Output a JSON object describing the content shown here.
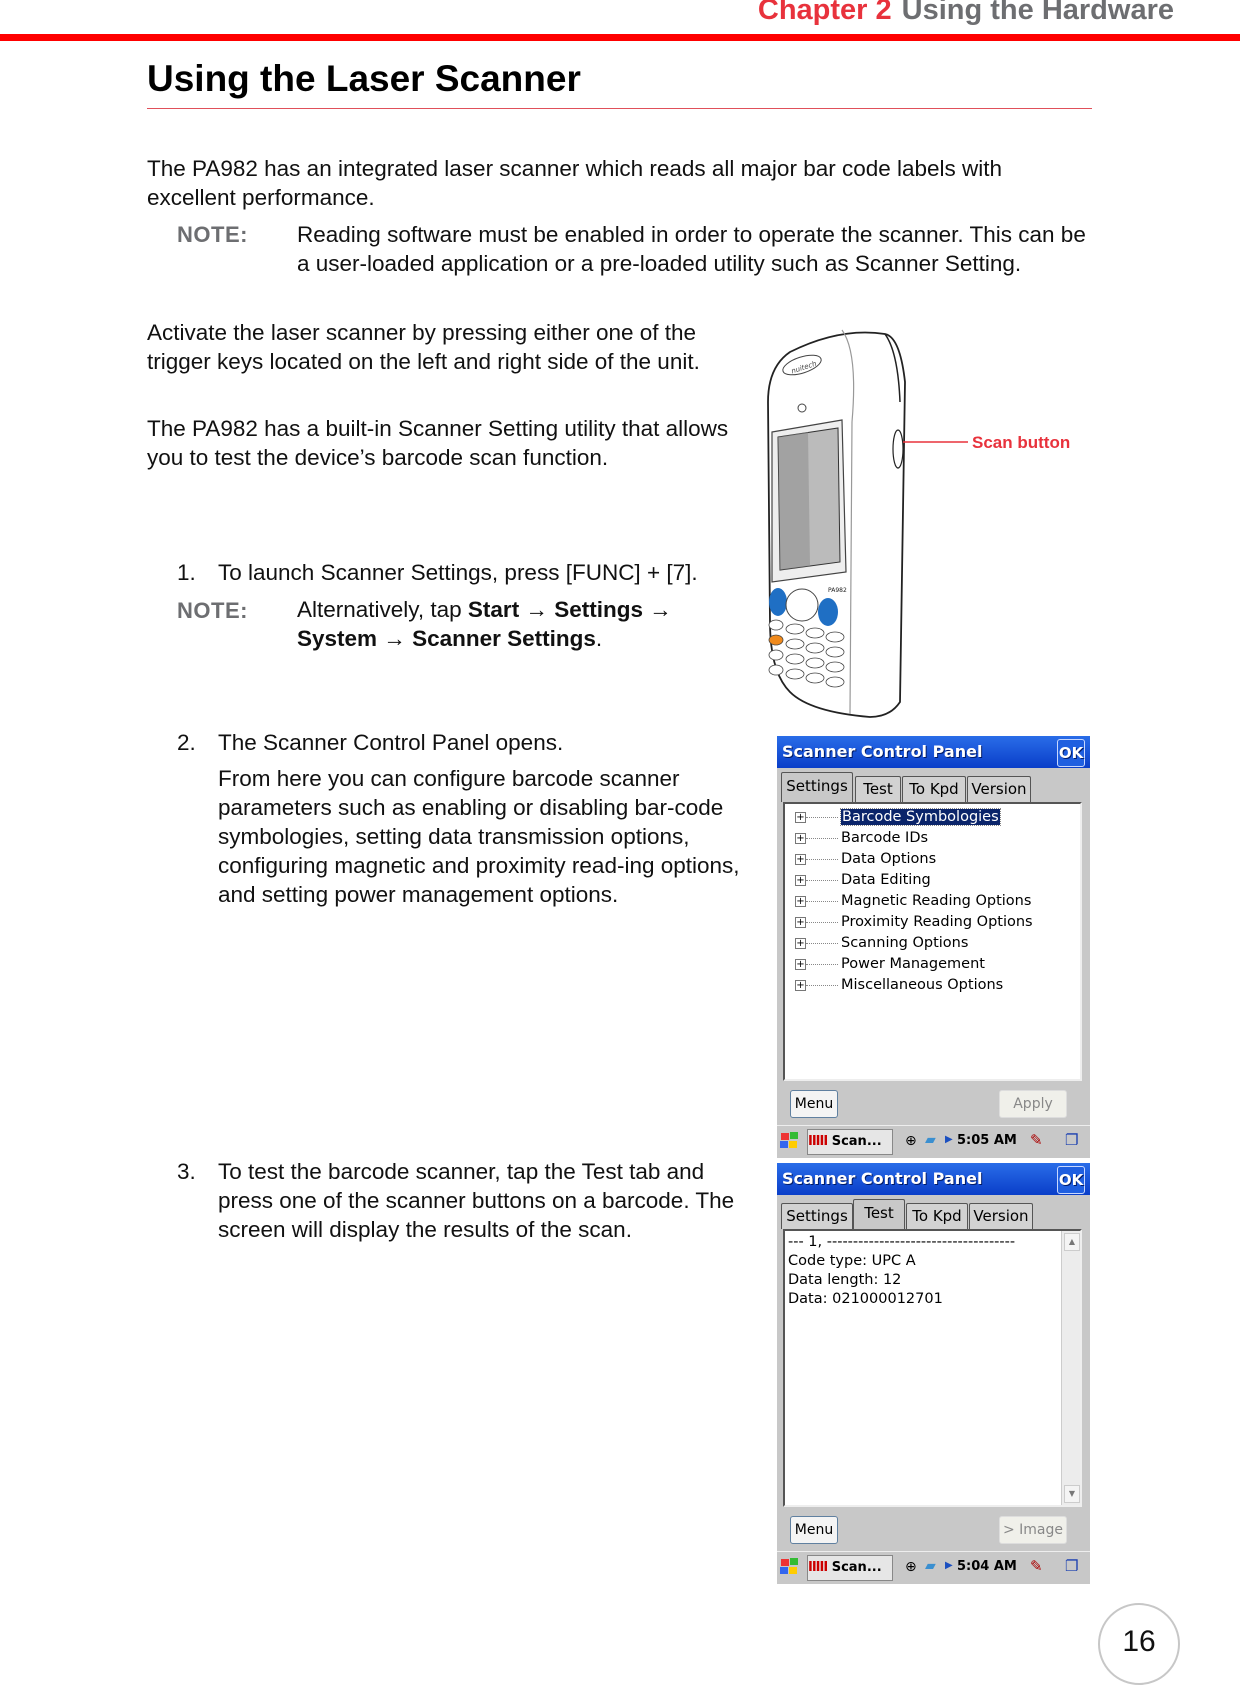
{
  "header": {
    "chapter_label": "Chapter 2",
    "chapter_title": "Using the Hardware",
    "accent_color": "#ff0000"
  },
  "section": {
    "title": "Using the Laser Scanner"
  },
  "intro": {
    "paragraph": "The PA982 has an integrated laser scanner which reads all major bar code labels with excellent performance.",
    "note_label": "NOTE:",
    "note_text": "Reading software must be enabled in order to operate the scanner. This can be a user-loaded application or a pre-loaded utility such as Scanner Setting."
  },
  "activate": {
    "paragraph1": "Activate the laser scanner by pressing either one of the trigger keys located on the left and right side of the unit.",
    "paragraph2": "The PA982 has a built-in Scanner Setting utility that allows you to test the device’s barcode scan function."
  },
  "device_figure": {
    "callout": "Scan button",
    "brand": "nuitech",
    "model": "PA982",
    "callout_color": "#e8323c"
  },
  "steps": [
    {
      "number": "1.",
      "text": "To launch Scanner Settings, press [FUNC] + [7].",
      "note_label": "NOTE:",
      "note_prefix": "Alternatively, tap ",
      "note_path": [
        "Start",
        "Settings",
        "System",
        "Scanner Settings"
      ],
      "arrow": "→",
      "note_suffix": "."
    },
    {
      "number": "2.",
      "text": "The Scanner Control Panel opens.",
      "detail": "From here you can configure barcode scanner parameters such as enabling or disabling bar-code symbologies, setting data transmission options, configuring magnetic and proximity read-ing options, and setting power management options."
    },
    {
      "number": "3.",
      "text": "To test the barcode scanner, tap the Test tab and press one of the scanner buttons on a barcode. The screen will display the results of the scan."
    }
  ],
  "panel_settings": {
    "title": "Scanner Control Panel",
    "ok_label": "OK",
    "tabs": [
      "Settings",
      "Test",
      "To Kpd",
      "Version"
    ],
    "active_tab": "Settings",
    "tree_items": [
      "Barcode Symbologies",
      "Barcode IDs",
      "Data Options",
      "Data Editing",
      "Magnetic Reading Options",
      "Proximity Reading Options",
      "Scanning Options",
      "Power Management",
      "Miscellaneous Options"
    ],
    "selected_item": "Barcode Symbologies",
    "menu_label": "Menu",
    "action_label": "Apply",
    "taskbar": {
      "task_label": "Scan...",
      "time": "5:05 AM"
    }
  },
  "panel_test": {
    "title": "Scanner Control Panel",
    "ok_label": "OK",
    "tabs": [
      "Settings",
      "Test",
      "To Kpd",
      "Version"
    ],
    "active_tab": "Test",
    "output_lines": [
      "--- 1, ------------------------------------",
      "Code type: UPC A",
      "Data length: 12",
      "Data: 021000012701"
    ],
    "menu_label": "Menu",
    "action_label": "> Image",
    "taskbar": {
      "task_label": "Scan...",
      "time": "5:04 AM"
    }
  },
  "footer": {
    "page_number": "16"
  }
}
